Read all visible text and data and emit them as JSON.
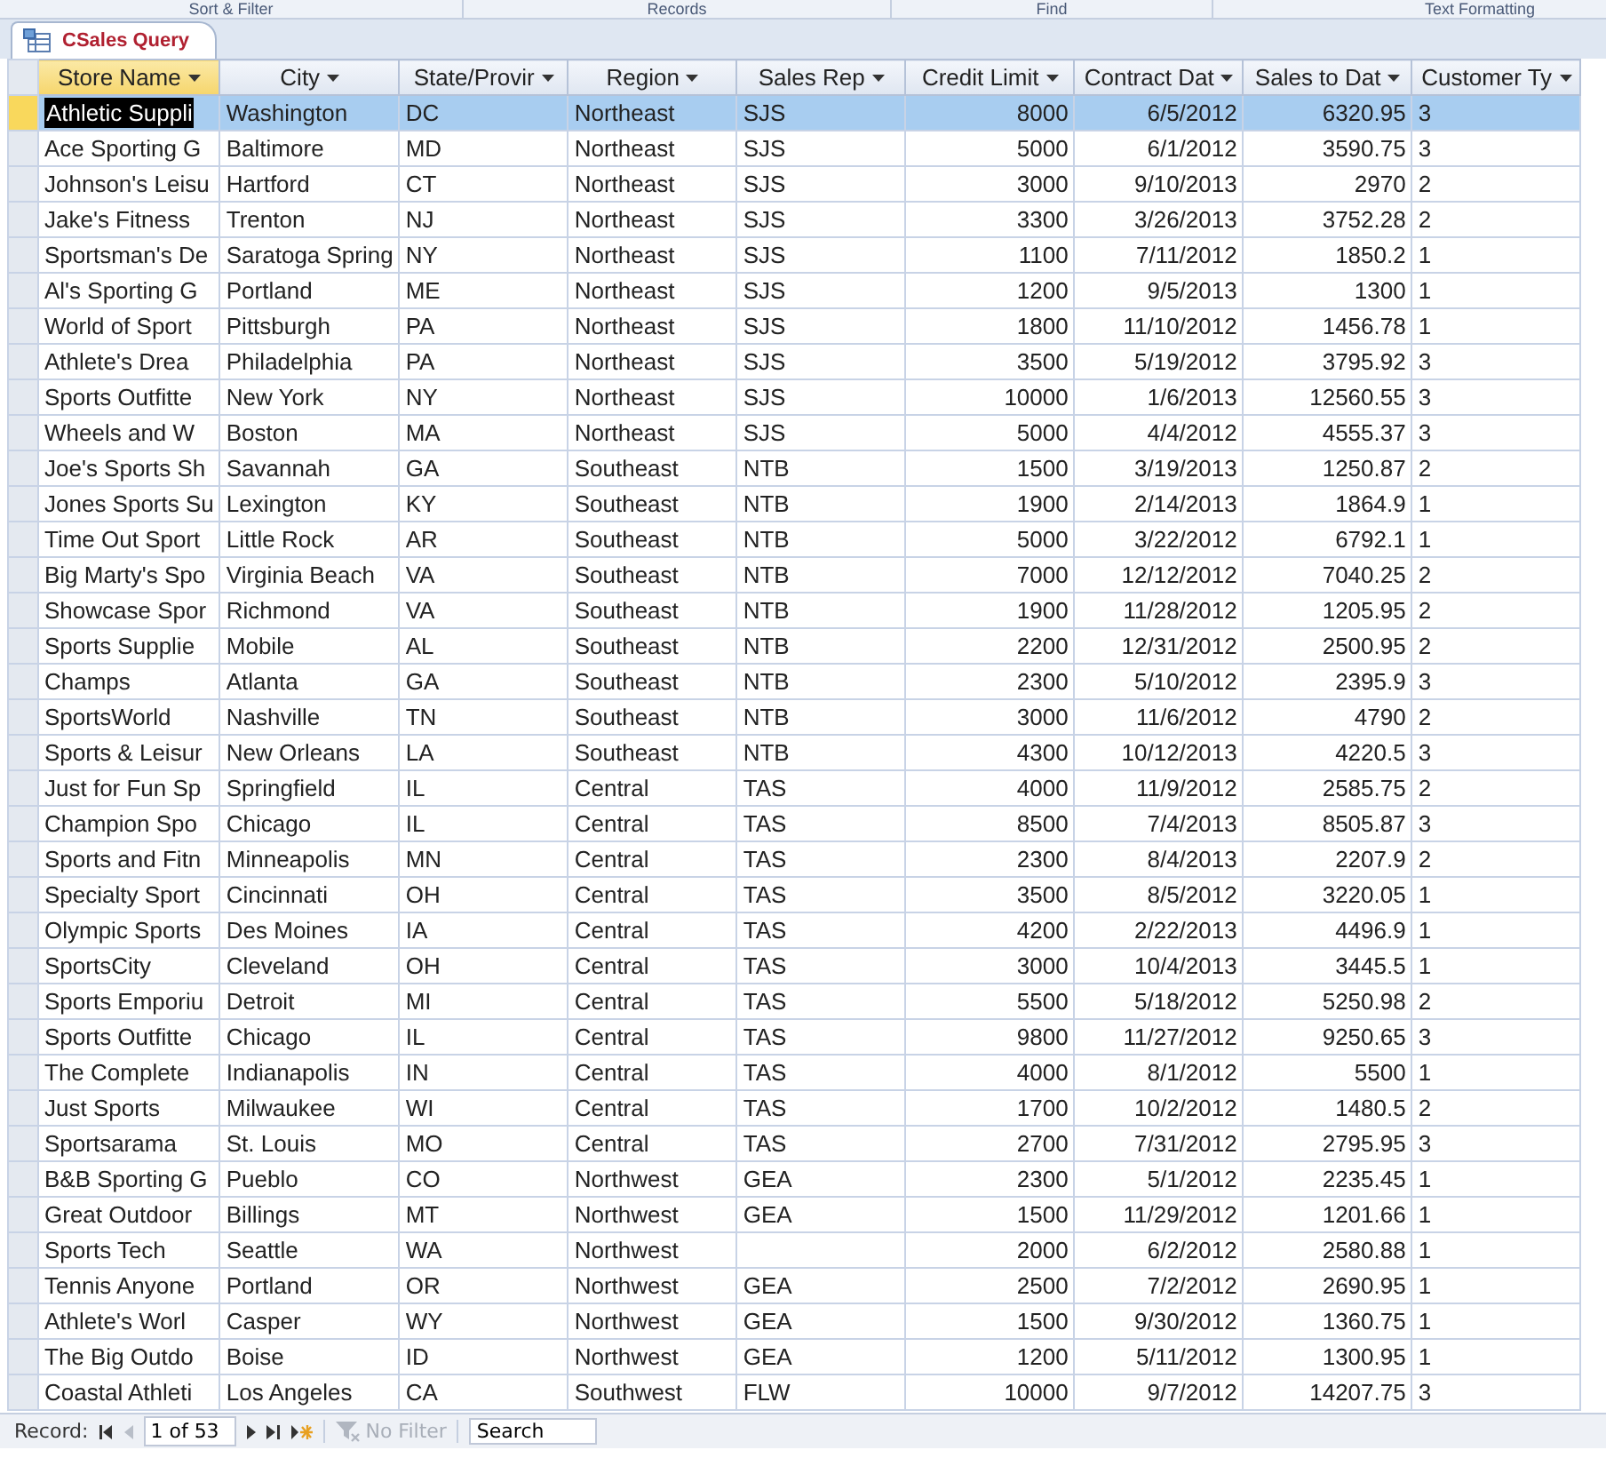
{
  "ribbon_groups": [
    "Sort & Filter",
    "Records",
    "Find",
    "Text Formatting"
  ],
  "tabs": [
    {
      "title": "CSales Query",
      "selected": true
    }
  ],
  "table": {
    "columns": [
      {
        "label": "Store Name",
        "kind": "text",
        "selected": true
      },
      {
        "label": "City",
        "kind": "text",
        "selected": false
      },
      {
        "label": "State/Provir",
        "kind": "text",
        "selected": false
      },
      {
        "label": "Region",
        "kind": "text",
        "selected": false
      },
      {
        "label": "Sales Rep",
        "kind": "text",
        "selected": false
      },
      {
        "label": "Credit Limit",
        "kind": "number",
        "selected": false
      },
      {
        "label": "Contract Dat",
        "kind": "number",
        "selected": false
      },
      {
        "label": "Sales to Dat",
        "kind": "number",
        "selected": false
      },
      {
        "label": "Customer Ty",
        "kind": "text",
        "selected": false
      }
    ],
    "rows": [
      {
        "selected": true,
        "cells": [
          "Athletic Suppli",
          "Washington",
          "DC",
          "Northeast",
          "SJS",
          "8000",
          "6/5/2012",
          "6320.95",
          "3"
        ]
      },
      {
        "selected": false,
        "cells": [
          "Ace Sporting G",
          "Baltimore",
          "MD",
          "Northeast",
          "SJS",
          "5000",
          "6/1/2012",
          "3590.75",
          "3"
        ]
      },
      {
        "selected": false,
        "cells": [
          "Johnson's Leisu",
          "Hartford",
          "CT",
          "Northeast",
          "SJS",
          "3000",
          "9/10/2013",
          "2970",
          "2"
        ]
      },
      {
        "selected": false,
        "cells": [
          "Jake's Fitness",
          "Trenton",
          "NJ",
          "Northeast",
          "SJS",
          "3300",
          "3/26/2013",
          "3752.28",
          "2"
        ]
      },
      {
        "selected": false,
        "cells": [
          "Sportsman's De",
          "Saratoga Spring",
          "NY",
          "Northeast",
          "SJS",
          "1100",
          "7/11/2012",
          "1850.2",
          "1"
        ]
      },
      {
        "selected": false,
        "cells": [
          "Al's Sporting G",
          "Portland",
          "ME",
          "Northeast",
          "SJS",
          "1200",
          "9/5/2013",
          "1300",
          "1"
        ]
      },
      {
        "selected": false,
        "cells": [
          "World of Sport",
          "Pittsburgh",
          "PA",
          "Northeast",
          "SJS",
          "1800",
          "11/10/2012",
          "1456.78",
          "1"
        ]
      },
      {
        "selected": false,
        "cells": [
          "Athlete's Drea",
          "Philadelphia",
          "PA",
          "Northeast",
          "SJS",
          "3500",
          "5/19/2012",
          "3795.92",
          "3"
        ]
      },
      {
        "selected": false,
        "cells": [
          "Sports Outfitte",
          "New York",
          "NY",
          "Northeast",
          "SJS",
          "10000",
          "1/6/2013",
          "12560.55",
          "3"
        ]
      },
      {
        "selected": false,
        "cells": [
          "Wheels and W",
          "Boston",
          "MA",
          "Northeast",
          "SJS",
          "5000",
          "4/4/2012",
          "4555.37",
          "3"
        ]
      },
      {
        "selected": false,
        "cells": [
          "Joe's Sports Sh",
          "Savannah",
          "GA",
          "Southeast",
          "NTB",
          "1500",
          "3/19/2013",
          "1250.87",
          "2"
        ]
      },
      {
        "selected": false,
        "cells": [
          "Jones Sports Su",
          "Lexington",
          "KY",
          "Southeast",
          "NTB",
          "1900",
          "2/14/2013",
          "1864.9",
          "1"
        ]
      },
      {
        "selected": false,
        "cells": [
          "Time Out Sport",
          "Little Rock",
          "AR",
          "Southeast",
          "NTB",
          "5000",
          "3/22/2012",
          "6792.1",
          "1"
        ]
      },
      {
        "selected": false,
        "cells": [
          "Big Marty's Spo",
          "Virginia Beach",
          "VA",
          "Southeast",
          "NTB",
          "7000",
          "12/12/2012",
          "7040.25",
          "2"
        ]
      },
      {
        "selected": false,
        "cells": [
          "Showcase Spor",
          "Richmond",
          "VA",
          "Southeast",
          "NTB",
          "1900",
          "11/28/2012",
          "1205.95",
          "2"
        ]
      },
      {
        "selected": false,
        "cells": [
          "Sports Supplie",
          "Mobile",
          "AL",
          "Southeast",
          "NTB",
          "2200",
          "12/31/2012",
          "2500.95",
          "2"
        ]
      },
      {
        "selected": false,
        "cells": [
          "Champs",
          "Atlanta",
          "GA",
          "Southeast",
          "NTB",
          "2300",
          "5/10/2012",
          "2395.9",
          "3"
        ]
      },
      {
        "selected": false,
        "cells": [
          "SportsWorld",
          "Nashville",
          "TN",
          "Southeast",
          "NTB",
          "3000",
          "11/6/2012",
          "4790",
          "2"
        ]
      },
      {
        "selected": false,
        "cells": [
          "Sports & Leisur",
          "New Orleans",
          "LA",
          "Southeast",
          "NTB",
          "4300",
          "10/12/2013",
          "4220.5",
          "3"
        ]
      },
      {
        "selected": false,
        "cells": [
          "Just for Fun Sp",
          "Springfield",
          "IL",
          "Central",
          "TAS",
          "4000",
          "11/9/2012",
          "2585.75",
          "2"
        ]
      },
      {
        "selected": false,
        "cells": [
          "Champion Spo",
          "Chicago",
          "IL",
          "Central",
          "TAS",
          "8500",
          "7/4/2013",
          "8505.87",
          "3"
        ]
      },
      {
        "selected": false,
        "cells": [
          "Sports and Fitn",
          "Minneapolis",
          "MN",
          "Central",
          "TAS",
          "2300",
          "8/4/2013",
          "2207.9",
          "2"
        ]
      },
      {
        "selected": false,
        "cells": [
          "Specialty Sport",
          "Cincinnati",
          "OH",
          "Central",
          "TAS",
          "3500",
          "8/5/2012",
          "3220.05",
          "1"
        ]
      },
      {
        "selected": false,
        "cells": [
          "Olympic Sports",
          "Des Moines",
          "IA",
          "Central",
          "TAS",
          "4200",
          "2/22/2013",
          "4496.9",
          "1"
        ]
      },
      {
        "selected": false,
        "cells": [
          "SportsCity",
          "Cleveland",
          "OH",
          "Central",
          "TAS",
          "3000",
          "10/4/2013",
          "3445.5",
          "1"
        ]
      },
      {
        "selected": false,
        "cells": [
          "Sports Emporiu",
          "Detroit",
          "MI",
          "Central",
          "TAS",
          "5500",
          "5/18/2012",
          "5250.98",
          "2"
        ]
      },
      {
        "selected": false,
        "cells": [
          "Sports Outfitte",
          "Chicago",
          "IL",
          "Central",
          "TAS",
          "9800",
          "11/27/2012",
          "9250.65",
          "3"
        ]
      },
      {
        "selected": false,
        "cells": [
          "The Complete",
          "Indianapolis",
          "IN",
          "Central",
          "TAS",
          "4000",
          "8/1/2012",
          "5500",
          "1"
        ]
      },
      {
        "selected": false,
        "cells": [
          "Just Sports",
          "Milwaukee",
          "WI",
          "Central",
          "TAS",
          "1700",
          "10/2/2012",
          "1480.5",
          "2"
        ]
      },
      {
        "selected": false,
        "cells": [
          "Sportsarama",
          "St. Louis",
          "MO",
          "Central",
          "TAS",
          "2700",
          "7/31/2012",
          "2795.95",
          "3"
        ]
      },
      {
        "selected": false,
        "cells": [
          "B&B Sporting G",
          "Pueblo",
          "CO",
          "Northwest",
          "GEA",
          "2300",
          "5/1/2012",
          "2235.45",
          "1"
        ]
      },
      {
        "selected": false,
        "cells": [
          "Great Outdoor",
          "Billings",
          "MT",
          "Northwest",
          "GEA",
          "1500",
          "11/29/2012",
          "1201.66",
          "1"
        ]
      },
      {
        "selected": false,
        "cells": [
          "Sports Tech",
          "Seattle",
          "WA",
          "Northwest",
          "",
          "2000",
          "6/2/2012",
          "2580.88",
          "1"
        ]
      },
      {
        "selected": false,
        "cells": [
          "Tennis Anyone",
          "Portland",
          "OR",
          "Northwest",
          "GEA",
          "2500",
          "7/2/2012",
          "2690.95",
          "1"
        ]
      },
      {
        "selected": false,
        "cells": [
          "Athlete's Worl",
          "Casper",
          "WY",
          "Northwest",
          "GEA",
          "1500",
          "9/30/2012",
          "1360.75",
          "1"
        ]
      },
      {
        "selected": false,
        "cells": [
          "The Big Outdo",
          "Boise",
          "ID",
          "Northwest",
          "GEA",
          "1200",
          "5/11/2012",
          "1300.95",
          "1"
        ]
      },
      {
        "selected": false,
        "cells": [
          "Coastal Athleti",
          "Los Angeles",
          "CA",
          "Southwest",
          "FLW",
          "10000",
          "9/7/2012",
          "14207.75",
          "3"
        ]
      }
    ]
  },
  "record_nav": {
    "label": "Record:",
    "position": "1 of 53",
    "filter": {
      "label": "No Filter",
      "disabled": true
    },
    "search": {
      "placeholder": "Search"
    }
  }
}
